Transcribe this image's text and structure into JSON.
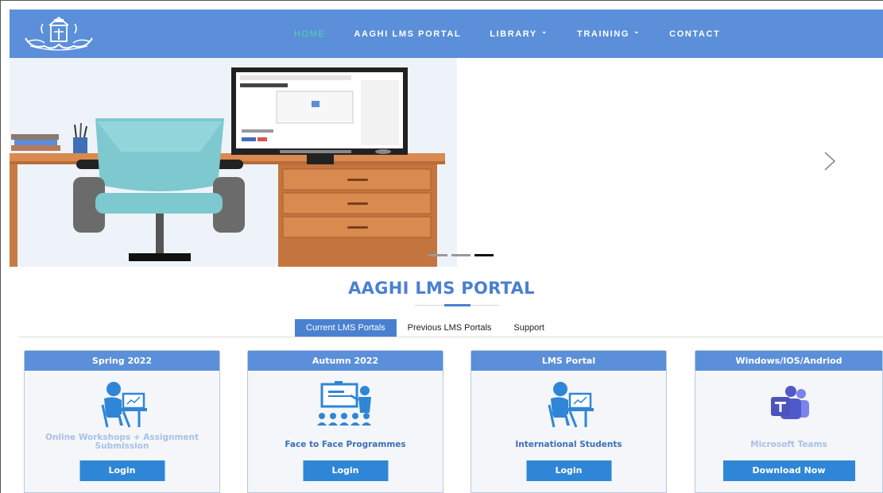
{
  "nav": {
    "logo_icon": "university-seal-logo",
    "items": [
      {
        "label": "HOME",
        "active": true,
        "dropdown": false
      },
      {
        "label": "AAGHI LMS PORTAL",
        "active": false,
        "dropdown": false
      },
      {
        "label": "LIBRARY",
        "active": false,
        "dropdown": true
      },
      {
        "label": "TRAINING",
        "active": false,
        "dropdown": true
      },
      {
        "label": "CONTACT",
        "active": false,
        "dropdown": false
      }
    ]
  },
  "hero": {
    "slides_count": 3,
    "active_slide": 3,
    "next_icon": "chevron-right-icon"
  },
  "section": {
    "title": "AAGHI LMS PORTAL"
  },
  "tabs": [
    {
      "label": "Current LMS Portals",
      "active": true
    },
    {
      "label": "Previous LMS Portals",
      "active": false
    },
    {
      "label": "Support",
      "active": false
    }
  ],
  "cards": [
    {
      "header": "Spring 2022",
      "icon": "student-laptop-icon",
      "subtitle": "Online Workshops + Assignment Submission",
      "button": "Login"
    },
    {
      "header": "Autumn 2022",
      "icon": "classroom-teacher-icon",
      "subtitle": "Face to Face Programmes",
      "button": "Login"
    },
    {
      "header": "LMS Portal",
      "icon": "student-laptop-icon",
      "subtitle": "International Students",
      "button": "Login"
    },
    {
      "header": "Windows/IOS/Andriod",
      "icon": "microsoft-teams-icon",
      "subtitle": "Microsoft Teams",
      "button": "Download Now"
    }
  ],
  "colors": {
    "navbar": "#5b8fd9",
    "accent": "#4a80d0",
    "active_nav": "#4cd9a4",
    "button": "#2f86d6"
  }
}
